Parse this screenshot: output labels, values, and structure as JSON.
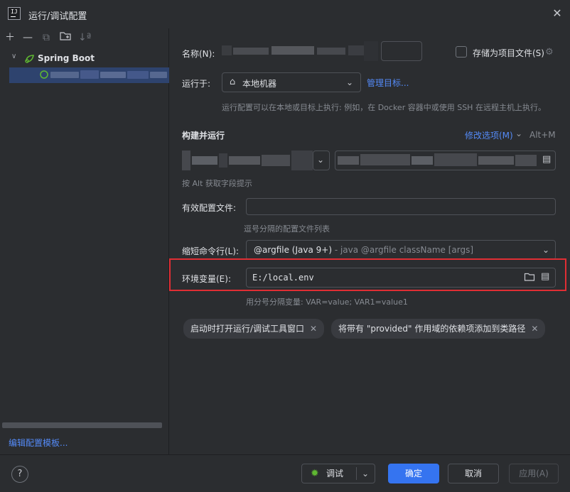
{
  "window": {
    "title": "运行/调试配置",
    "close_icon": "close-icon"
  },
  "left": {
    "toolbar": [
      "add-icon",
      "remove-icon",
      "copy-icon",
      "new-folder-icon",
      "sort-icon"
    ],
    "tree": {
      "group_label": "Spring Boot"
    },
    "edit_templates_link": "编辑配置模板..."
  },
  "form": {
    "name_label": "名称(N):",
    "store_as_file_label": "存储为项目文件(S)",
    "run_on_label": "运行于:",
    "run_on_value": "本地机器",
    "manage_targets_link": "管理目标...",
    "run_on_hint": "运行配置可以在本地或目标上执行: 例如，在 Docker 容器中或使用 SSH 在远程主机上执行。",
    "build_run_title": "构建并运行",
    "modify_options_link": "修改选项(M)",
    "modify_options_shortcut": "Alt+M",
    "build_hint": "按 Alt 获取字段提示",
    "profiles_label": "有效配置文件:",
    "profiles_value": "",
    "profiles_hint": "逗号分隔的配置文件列表",
    "shorten_label": "缩短命令行(L):",
    "shorten_value": "@argfile (Java 9+)",
    "shorten_value_detail": " - java @argfile className [args]",
    "env_label": "环境变量(E):",
    "env_value": "E:/local.env",
    "env_hint": "用分号分隔变量: VAR=value; VAR1=value1",
    "chips": [
      "启动时打开运行/调试工具窗口",
      "将带有 \"provided\" 作用域的依赖项添加到类路径"
    ]
  },
  "footer": {
    "help_label": "?",
    "debug_label": "调试",
    "ok_label": "确定",
    "cancel_label": "取消",
    "apply_label": "应用(A)"
  },
  "colors": {
    "accent": "#3574f0",
    "link": "#548af7",
    "highlight_border": "#e02e34",
    "selection": "#2e436e"
  }
}
